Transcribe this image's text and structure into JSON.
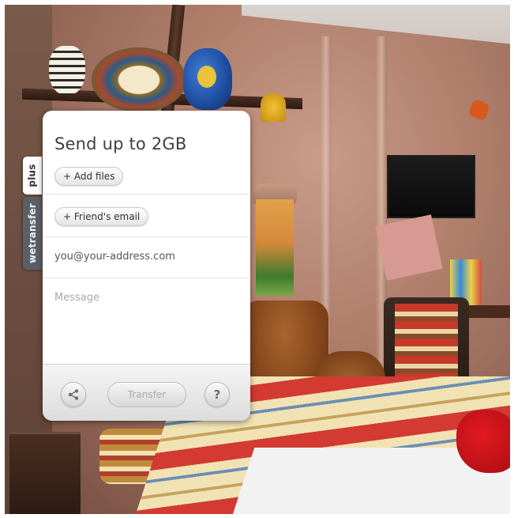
{
  "side_tabs": {
    "plus": "plus",
    "wetransfer": "wetransfer"
  },
  "panel": {
    "title": "Send up to 2GB",
    "add_files_label": "+ Add files",
    "friends_email_label": "+ Friend's email",
    "your_email_value": "you@your-address.com",
    "message_placeholder": "Message",
    "transfer_label": "Transfer",
    "help_label": "?"
  },
  "icons": {
    "share": "share-icon",
    "help": "question-icon"
  },
  "colors": {
    "panel_bg": "#ffffff",
    "wetransfer_tab": "#5a6068",
    "text_dark": "#3f3f3f",
    "transfer_text_disabled": "#a9a9a9"
  }
}
